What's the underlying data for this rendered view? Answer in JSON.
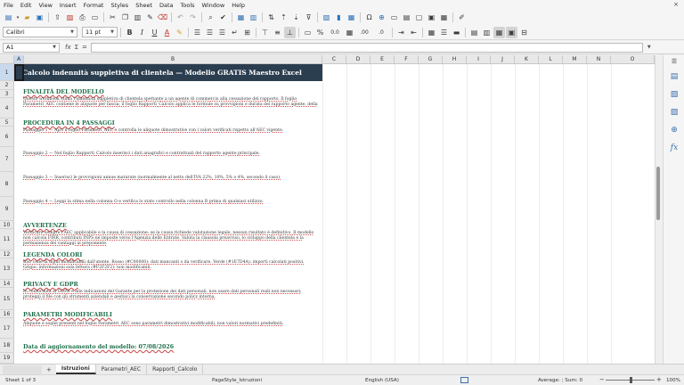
{
  "menu": {
    "items": [
      "File",
      "Edit",
      "View",
      "Insert",
      "Format",
      "Styles",
      "Sheet",
      "Data",
      "Tools",
      "Window",
      "Help"
    ],
    "close": "×"
  },
  "toolbar": {
    "font_name": "Calibri",
    "font_size": "11 pt",
    "bold": "B",
    "italic": "I",
    "underline": "U",
    "font_color": "A",
    "percent": "%",
    "decimal_zero": "0.0",
    "add_decimal": ".00",
    "remove_decimal": ".0"
  },
  "formula_bar": {
    "cell_ref": "A1",
    "fx": "fx",
    "sigma": "Σ",
    "equals": "=",
    "content": ""
  },
  "columns": [
    "A",
    "B",
    "C",
    "D",
    "E",
    "F",
    "G",
    "H",
    "I",
    "J",
    "K",
    "L",
    "M",
    "N",
    "O"
  ],
  "rows": [
    "1",
    "2",
    "3",
    "4",
    "5",
    "6",
    "7",
    "8",
    "9",
    "10",
    "11",
    "12",
    "13",
    "14",
    "15",
    "16",
    "17",
    "18",
    "19"
  ],
  "sheet": {
    "title": "Calcolo indennità suppletiva di clientela — Modello GRATIS Maestro Excel",
    "finalita_heading": "FINALITÀ DEL MODELLO",
    "finalita_body": "Questo workbook stima l'indennità suppletiva di clientela spettante a un agente di commercio alla cessazione del rapporto. Il foglio Parametri_AEC contiene le aliquote per fascia; il foglio Rapporti_Calcolo applica le formule su provvigioni e durata del rapporto agente, della",
    "procedura_heading": "PROCEDURA IN 4 PASSAGGI",
    "step1": "Passaggio 1 — Apri il foglio Parametri_AEC e controlla le aliquote dimostrative con i valori verificati rispetto all'AEC vigente.",
    "step2": "Passaggio 2 — Nel foglio Rapporti_Calcolo inserisci i dati anagrafici e contrattuali del rapporto agente principale.",
    "step3": "Passaggio 3 — Inserisci le provvigioni annue maturate (normalmente al netto dell'IVA 22%, 10%, 5% o 4%, secondo il caso).",
    "step4": "Passaggio 4 — Leggi la stima nella colonna O e verifica lo stato controllo nella colonna R prima di qualsiasi utilizzo.",
    "avvertenze_heading": "AVVERTENZE",
    "avvertenze_body": "Verificare sempre l'AEC applicabile e la causa di cessazione: se la causa richiede valutazione legale, nessun risultato è definitivo. Il modello non calcola FIRR, contributi INPS né imposte verso l'Agenzia delle Entrate. Valuta la clausola preavviso, lo sviluppo della clientela e la permanenza dei vantaggi al preponente.",
    "legenda_heading": "LEGENDA COLORI",
    "legenda_body": "Blu: celle di input modificabili dall'utente. Rosso (#C00000): dati mancanti o da verificare. Verde (#1E7D4A): importi calcolati positivi. Grigio: informazioni sola lettura (#F2F2F2): non modificabili.",
    "privacy_heading": "PRIVACY E GDPR",
    "privacy_body": "In conformità al GDPR e alle indicazioni del Garante per la protezione dei dati personali, non usare dati personali reali non necessari; proteggi il file con gli strumenti aziendali e gestisci la conservazione secondo policy interna.",
    "parametri_heading": "PARAMETRI MODIFICABILI",
    "parametri_body": "Aliquote e soglie presenti nel foglio Parametri_AEC sono parametri dimostrativi modificabili, non valori normativi predefiniti.",
    "date_label": "Data di aggiornamento del modello: 07/08/2026"
  },
  "tabs": {
    "add": "+",
    "items": [
      "Istruzioni",
      "Parametri_AEC",
      "Rapporti_Calcolo"
    ],
    "active": "Istruzioni"
  },
  "status": {
    "sheet_info": "Sheet 1 of 3",
    "page_style": "PageStyle_Istruzioni",
    "language": "English (USA)",
    "summary": "Average: ; Sum: 0",
    "zoom": "100%"
  },
  "colors": {
    "title_band": "#2b3e50",
    "heading_green": "#1f6f4a",
    "selection": "#c9d9ee"
  }
}
